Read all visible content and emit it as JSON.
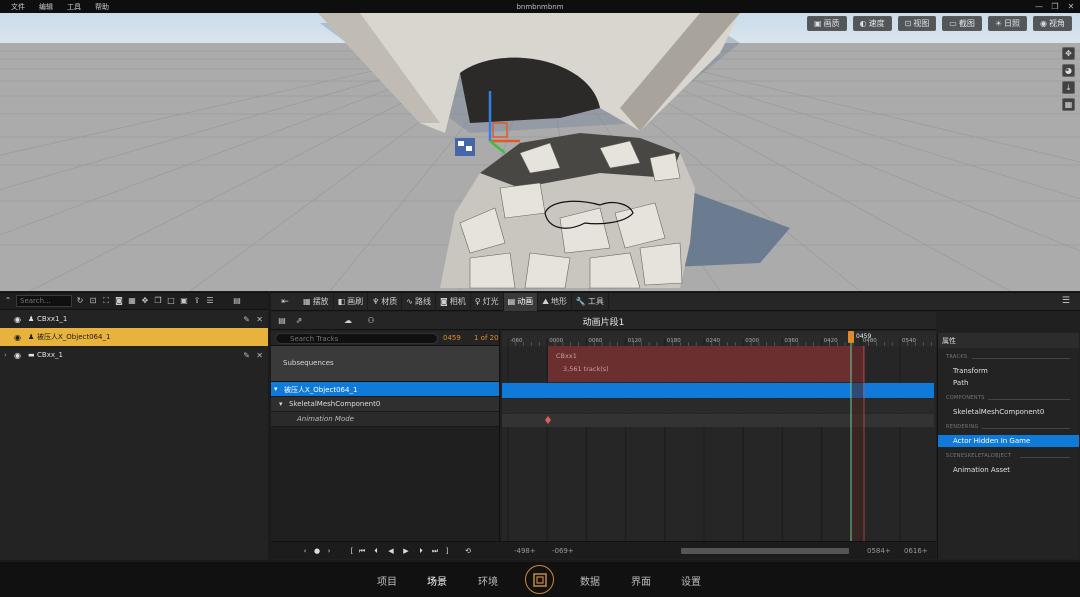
{
  "titlebar": {
    "menu": [
      "文件",
      "编辑",
      "工具",
      "帮助"
    ],
    "title": "bnmbnmbnm",
    "controls": [
      "—",
      "❐",
      "✕"
    ]
  },
  "viewport": {
    "toolbar": [
      {
        "icon": "▣",
        "label": "画质"
      },
      {
        "icon": "◐",
        "label": "速度"
      },
      {
        "icon": "⊡",
        "label": "视图"
      },
      {
        "icon": "▭",
        "label": "截图"
      },
      {
        "icon": "☀",
        "label": "日照"
      },
      {
        "icon": "◉",
        "label": "视角"
      }
    ],
    "side_icons": [
      "✥",
      "◕",
      "⤓",
      "▦"
    ]
  },
  "outliner": {
    "search_placeholder": "Search...",
    "rows": [
      {
        "label": "CBxx1_1",
        "selected": false
      },
      {
        "label": "被压人X_Object064_1",
        "selected": true
      },
      {
        "label": "CBxx_1",
        "selected": false
      }
    ]
  },
  "sequencer": {
    "tabs": [
      {
        "icon": "▦",
        "label": "摆放"
      },
      {
        "icon": "◧",
        "label": "画刷"
      },
      {
        "icon": "♆",
        "label": "材质"
      },
      {
        "icon": "∿",
        "label": "路线"
      },
      {
        "icon": "◙",
        "label": "相机"
      },
      {
        "icon": "♀",
        "label": "灯光"
      },
      {
        "icon": "▤",
        "label": "动画"
      },
      {
        "icon": "⛰",
        "label": "地形"
      },
      {
        "icon": "🔧",
        "label": "工具"
      }
    ],
    "active_tab": "动画",
    "title": "动画片段1",
    "track_search_placeholder": "Search Tracks",
    "current_frame": "0459",
    "frame_count": "1 of 20",
    "subsequences_label": "Subsequences",
    "tracks": {
      "actor": "被压人X_Object064_1",
      "component": "SkeletalMeshComponent0",
      "animation_mode": "Animation Mode"
    },
    "ruler_labels": [
      "-060",
      "0000",
      "0060",
      "0120",
      "0180",
      "0240",
      "0300",
      "0360",
      "0420",
      "0480",
      "0540"
    ],
    "playhead_label": "0459",
    "section": {
      "name": "CBxx1",
      "tracks": "3,561 track(s)"
    },
    "transport": {
      "buttons": [
        "‹",
        "●",
        "›",
        "[",
        "⏮",
        "⏴",
        "◀",
        "▶",
        "⏵",
        "⏭",
        "]",
        "⟲"
      ],
      "range_start": "-498+",
      "view_start": "-069+",
      "view_end": "0584+",
      "range_end": "0616+"
    }
  },
  "properties": {
    "header": "属性",
    "sections": [
      {
        "name": "TRACKS",
        "items": [
          "Transform",
          "Path"
        ]
      },
      {
        "name": "COMPONENTS",
        "items": [
          "SkeletalMeshComponent0"
        ]
      },
      {
        "name": "RENDERING",
        "items": [
          "Actor Hidden In Game"
        ]
      },
      {
        "name": "SCENESKELETALOBJECT",
        "items": [
          "Animation Asset"
        ]
      }
    ],
    "selected_item": "Actor Hidden In Game"
  },
  "bottomnav": {
    "items": [
      "项目",
      "场景",
      "环境",
      "数据",
      "界面",
      "设置"
    ],
    "active": "场景"
  },
  "colors": {
    "accent_blue": "#0f7ad8",
    "selection_yellow": "#e8b33c",
    "playhead_orange": "#e08a2e",
    "section_red": "#6b2f2f"
  }
}
